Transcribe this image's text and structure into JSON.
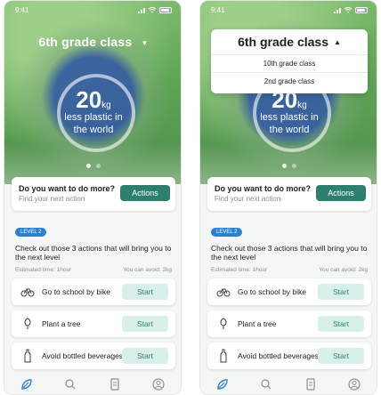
{
  "status": {
    "time": "9:41"
  },
  "hero": {
    "title": "6th grade class",
    "value": "20",
    "unit": "kg",
    "subtitle_line1": "less plastic in",
    "subtitle_line2": "the world"
  },
  "prompt": {
    "question": "Do you want to do more?",
    "sub": "Find your next action",
    "button": "Actions"
  },
  "section": {
    "badge": "LEVEL 2",
    "heading": "Check out those 3 actions that will bring you to the next level",
    "estimated": "Estimated time: 1hour",
    "avoid": "You can avoid: 2kg"
  },
  "actions": [
    {
      "label": "Go to school by bike",
      "button": "Start",
      "icon": "bike-icon"
    },
    {
      "label": "Plant a tree",
      "button": "Start",
      "icon": "tree-icon"
    },
    {
      "label": "Avoid bottled beverages",
      "button": "Start",
      "icon": "bottle-icon"
    }
  ],
  "dropdown": {
    "selected": "6th grade class",
    "options": [
      "10th grade class",
      "2nd grade class"
    ]
  },
  "tabs": [
    "leaf-icon",
    "search-icon",
    "document-icon",
    "profile-icon"
  ],
  "colors": {
    "accent": "#2f7f6f",
    "soft_accent": "#d9efe9",
    "badge": "#2f7fd0"
  }
}
